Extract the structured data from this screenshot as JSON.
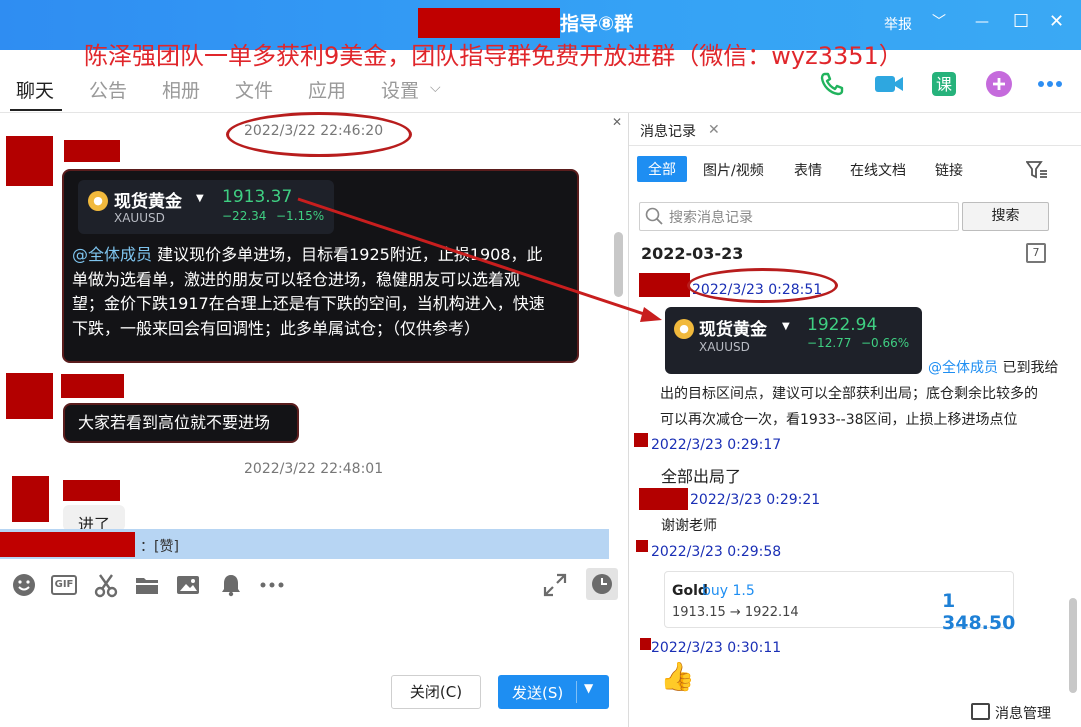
{
  "titlebar": {
    "group_name_suffix": "指导⑧群",
    "report_label": "举报",
    "collapse_glyph": "﹀",
    "minimize_glyph": "—",
    "maximize_glyph": "☐",
    "close_glyph": "✕"
  },
  "promo_text": "陈泽强团队一单多获利9美金，团队指导群免费开放进群（微信：wyz3351）",
  "nav": {
    "tabs": [
      "聊天",
      "公告",
      "相册",
      "文件",
      "应用",
      "设置"
    ],
    "dropdown_glyph": "⌵"
  },
  "chat": {
    "timestamp1": "2022/3/22 22:46:20",
    "timestamp2": "2022/3/22 22:48:01",
    "gold_card": {
      "name": "现货黄金",
      "code": "XAUUSD",
      "price": "1913.37",
      "change": "−22.34",
      "change_pct": "−1.15%"
    },
    "message1": {
      "mention": "@全体成员",
      "lines": [
        " 建议现价多单进场，目标看1925附近，止损1908，此",
        "单做为选看单，激进的朋友可以轻仓进场，稳健朋友可以选着观",
        "望；金价下跌1917在合理上还是有下跌的空间，当机构进入，快速",
        "下跌，一般来回会有回调性；此多单属试仓；（仅供参考）"
      ]
    },
    "message2": "大家若看到高位就不要进场",
    "message3": "进了",
    "reply_text": "：[赞]"
  },
  "input_toolbar": {
    "close_label": "关闭(C)",
    "send_label": "发送(S)"
  },
  "history_panel": {
    "tab_title": "消息记录",
    "filters": [
      "全部",
      "图片/视频",
      "表情",
      "在线文档",
      "链接"
    ],
    "search_placeholder": "搜索消息记录",
    "search_button": "搜索",
    "date": "2022-03-23",
    "calendar_day": "7",
    "entries": {
      "t1": "2022/3/23 0:28:51",
      "gold_card": {
        "name": "现货黄金",
        "code": "XAUUSD",
        "price": "1922.94",
        "change": "−12.77",
        "change_pct": "−0.66%"
      },
      "msg1_mention": "@全体成员",
      "msg1_lines": [
        "已到我给",
        "出的目标区间点，建议可以全部获利出局；底仓剩余比较多的",
        "可以再次减仓一次，看1933--38区间，止损上移进场点位"
      ],
      "t2": "2022/3/23 0:29:17",
      "msg2": "全部出局了",
      "t3": "2022/3/23 0:29:21",
      "msg3": "谢谢老师",
      "t4": "2022/3/23 0:29:58",
      "trade": {
        "symbol": "Gold",
        "side": "buy 1.5",
        "prices": "1913.15 → 1922.14",
        "profit": "1 348.50"
      },
      "t5": "2022/3/23 0:30:11",
      "thumb": "👍"
    },
    "manager_label": "消息管理"
  },
  "colors": {
    "titlebar": "#2f8df2",
    "accent_blue": "#1e8ef2",
    "redact_red": "#b30000",
    "promo_red": "#e0262b",
    "gain_green": "#3fcf82",
    "timestamp_blue": "#1a2fb5"
  },
  "icons": [
    "phone-icon",
    "video-icon",
    "class-icon",
    "add-icon",
    "more-icon",
    "emoji-icon",
    "gif-icon",
    "scissors-icon",
    "folder-icon",
    "image-icon",
    "bell-icon",
    "expand-icon",
    "clock-icon",
    "search-icon",
    "filter-icon",
    "calendar-icon"
  ]
}
